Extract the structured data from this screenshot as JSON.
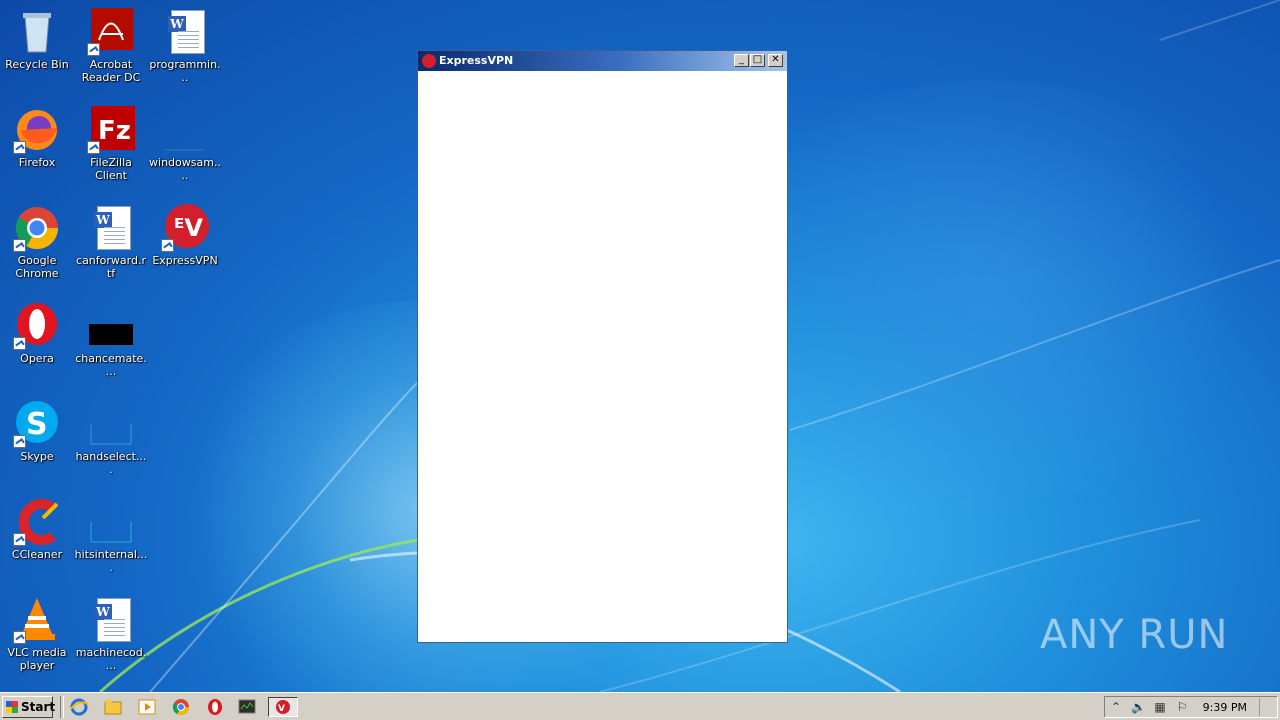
{
  "desktop": {
    "icons": [
      {
        "label": "Recycle Bin",
        "icon": "recycle-bin-icon"
      },
      {
        "label": "Acrobat Reader DC",
        "icon": "acrobat-icon"
      },
      {
        "label": "programmin...",
        "icon": "word-doc-icon"
      },
      {
        "label": "Firefox",
        "icon": "firefox-icon"
      },
      {
        "label": "FileZilla Client",
        "icon": "filezilla-icon"
      },
      {
        "label": "windowsam....",
        "icon": "blank-file-icon"
      },
      {
        "label": "Google Chrome",
        "icon": "chrome-icon"
      },
      {
        "label": "canforward.rtf",
        "icon": "word-doc-icon"
      },
      {
        "label": "ExpressVPN",
        "icon": "expressvpn-icon"
      },
      {
        "label": "Opera",
        "icon": "opera-icon"
      },
      {
        "label": "chancemate....",
        "icon": "black-file-icon"
      },
      {
        "label": "Skype",
        "icon": "skype-icon"
      },
      {
        "label": "handselect....",
        "icon": "blank-file-icon"
      },
      {
        "label": "CCleaner",
        "icon": "ccleaner-icon"
      },
      {
        "label": "hitsinternal....",
        "icon": "blank-file-icon"
      },
      {
        "label": "VLC media player",
        "icon": "vlc-icon"
      },
      {
        "label": "machinecod....",
        "icon": "word-doc-icon"
      }
    ],
    "watermark": "ANY RUN"
  },
  "window": {
    "title": "ExpressVPN",
    "minimize": "_",
    "maximize": "□",
    "close": "✕"
  },
  "taskbar": {
    "start_label": "Start",
    "clock": "9:39 PM"
  },
  "colors": {
    "expressvpn_red": "#d21f2b",
    "desktop_blue": "#1466c4"
  }
}
